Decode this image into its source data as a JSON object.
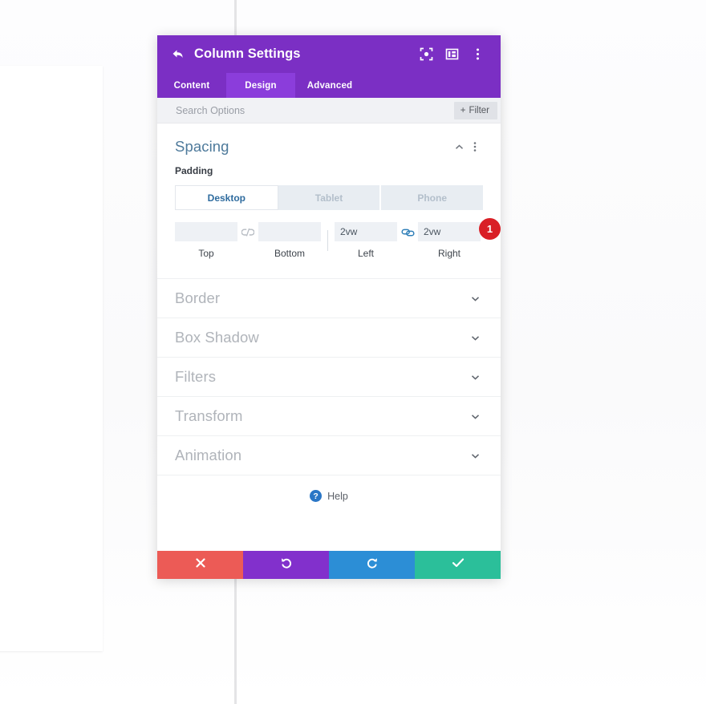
{
  "header": {
    "title": "Column Settings",
    "back_icon": "back-arrow-icon",
    "icons": [
      "focus-target-icon",
      "layout-panel-icon",
      "more-vertical-icon"
    ]
  },
  "tabs": [
    {
      "label": "Content",
      "active": false
    },
    {
      "label": "Design",
      "active": true
    },
    {
      "label": "Advanced",
      "active": false
    }
  ],
  "search": {
    "placeholder": "Search Options",
    "value": "",
    "filter_label": "Filter",
    "filter_icon": "plus-icon"
  },
  "spacing": {
    "title": "Spacing",
    "collapse_icon": "chevron-up-icon",
    "menu_icon": "more-vertical-icon",
    "field_label": "Padding",
    "devices": [
      {
        "label": "Desktop",
        "active": true
      },
      {
        "label": "Tablet",
        "active": false
      },
      {
        "label": "Phone",
        "active": false
      }
    ],
    "inputs": [
      {
        "caption": "Top",
        "value": "",
        "placeholder": ""
      },
      {
        "caption": "Bottom",
        "value": "",
        "placeholder": ""
      },
      {
        "caption": "Left",
        "value": "2vw",
        "placeholder": ""
      },
      {
        "caption": "Right",
        "value": "2vw",
        "placeholder": ""
      }
    ],
    "link_unlinked_icon": "chain-broken-icon",
    "link_linked_icon": "chain-linked-icon",
    "badge_count": "1"
  },
  "sections": [
    {
      "label": "Border",
      "icon": "chevron-down-icon"
    },
    {
      "label": "Box Shadow",
      "icon": "chevron-down-icon"
    },
    {
      "label": "Filters",
      "icon": "chevron-down-icon"
    },
    {
      "label": "Transform",
      "icon": "chevron-down-icon"
    },
    {
      "label": "Animation",
      "icon": "chevron-down-icon"
    }
  ],
  "help": {
    "label": "Help",
    "icon": "question-mark-icon"
  },
  "footer": [
    {
      "name": "cancel",
      "icon": "close-x-icon",
      "color": "#ec5b56"
    },
    {
      "name": "undo",
      "icon": "undo-arrow-icon",
      "color": "#8230cc"
    },
    {
      "name": "redo",
      "icon": "redo-arrow-icon",
      "color": "#2c8ed6"
    },
    {
      "name": "save",
      "icon": "check-icon",
      "color": "#2bbf9a"
    }
  ],
  "colors": {
    "header_purple": "#7b2fc4",
    "active_tab_purple": "#8b3ddb",
    "accent_blue": "#4e7a9b",
    "badge_red": "#d91f26"
  }
}
